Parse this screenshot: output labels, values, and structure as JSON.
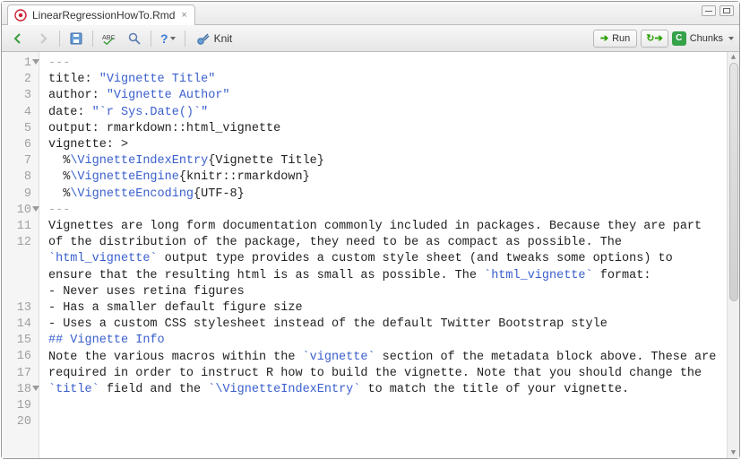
{
  "tab": {
    "filename": "LinearRegressionHowTo.Rmd"
  },
  "toolbar": {
    "knit_label": "Knit",
    "run_label": "Run",
    "chunks_label": "Chunks",
    "chunks_badge": "C"
  },
  "gutter": {
    "lines": [
      "1",
      "2",
      "3",
      "4",
      "5",
      "6",
      "7",
      "8",
      "9",
      "10",
      "11",
      "12",
      "",
      "",
      "",
      "13",
      "14",
      "15",
      "16",
      "17",
      "18",
      "19",
      "20",
      "",
      ""
    ]
  },
  "code": {
    "l1": "---",
    "l2_key": "title: ",
    "l2_val": "\"Vignette Title\"",
    "l3_key": "author: ",
    "l3_val": "\"Vignette Author\"",
    "l4_key": "date: ",
    "l4_val": "\"`r Sys.Date()`\"",
    "l5_key": "output: ",
    "l5_val": "rmarkdown::html_vignette",
    "l6_key": "vignette: ",
    "l6_val": ">",
    "l7_pre": "  %",
    "l7_cmd": "\\VignetteIndexEntry",
    "l7_arg": "{Vignette Title}",
    "l8_pre": "  %",
    "l8_cmd": "\\VignetteEngine",
    "l8_arg": "{knitr::rmarkdown}",
    "l9_pre": "  %",
    "l9_cmd": "\\VignetteEncoding",
    "l9_arg": "{UTF-8}",
    "l10": "---",
    "l11": "",
    "l12a": "Vignettes are long form documentation commonly included in packages. Because they are part of the distribution of the package, they need to be as compact as possible. The ",
    "l12b": "`html_vignette`",
    "l12c": " output type provides a custom style sheet (and tweaks some options) to ensure that the resulting html is as small as possible. The ",
    "l12d": "`html_vignette`",
    "l12e": " format:",
    "l13": "",
    "l14": "- Never uses retina figures",
    "l15": "- Has a smaller default figure size",
    "l16": "- Uses a custom CSS stylesheet instead of the default Twitter Bootstrap style",
    "l17": "",
    "l18": "## Vignette Info",
    "l19": "",
    "l20a": "Note the various macros within the ",
    "l20b": "`vignette`",
    "l20c": " section of the metadata block above. These are required in order to instruct R how to build the vignette. Note that you should change the ",
    "l20d": "`title`",
    "l20e": " field and the ",
    "l20f": "`\\VignetteIndexEntry`",
    "l20g": " to match the title of your vignette."
  }
}
